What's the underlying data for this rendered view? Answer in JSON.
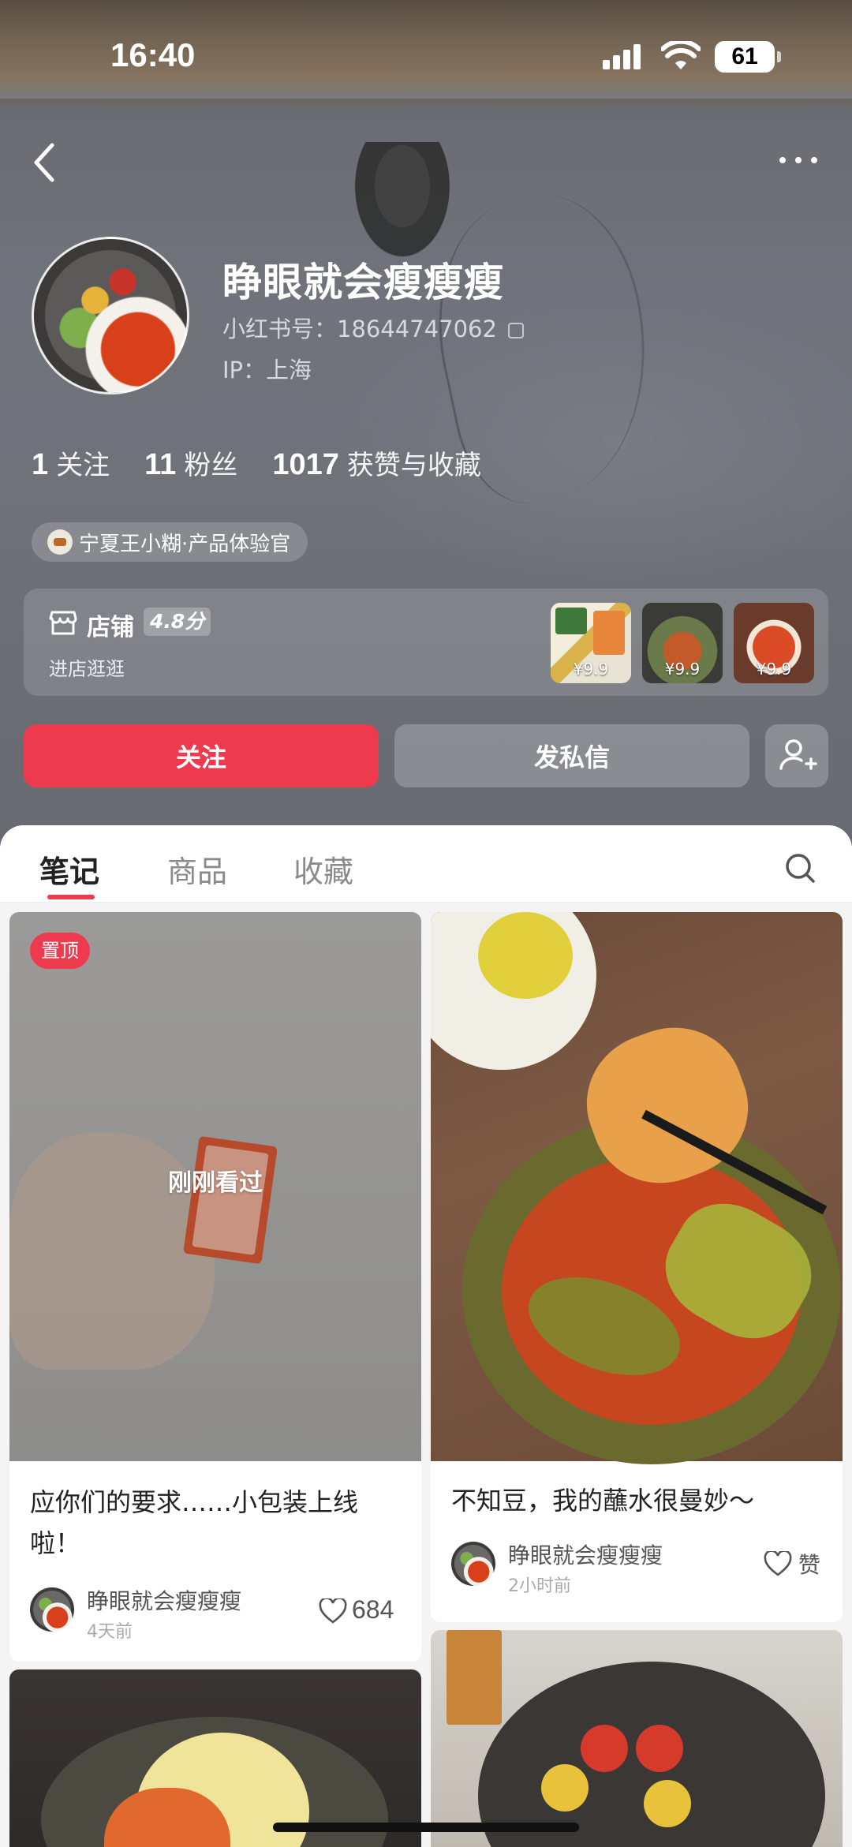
{
  "status_bar": {
    "time": "16:40",
    "battery": "61"
  },
  "profile": {
    "name": "睁眼就会瘦瘦瘦",
    "id_label": "小红书号：18644747062",
    "ip_label": "IP：上海",
    "brand_tag": "宁夏王小糊·产品体验官"
  },
  "stats": [
    {
      "value": "1",
      "label": "关注"
    },
    {
      "value": "11",
      "label": "粉丝"
    },
    {
      "value": "1017",
      "label": "获赞与收藏"
    }
  ],
  "store": {
    "title": "店铺",
    "rating": "4.8分",
    "subtitle": "进店逛逛",
    "products": [
      {
        "price": "¥9.9"
      },
      {
        "price": "¥9.9"
      },
      {
        "price": "¥9.9"
      }
    ]
  },
  "actions": {
    "follow": "关注",
    "message": "发私信"
  },
  "tabs": [
    {
      "label": "笔记",
      "active": true
    },
    {
      "label": "商品",
      "active": false
    },
    {
      "label": "收藏",
      "active": false
    }
  ],
  "notes": [
    {
      "badge": "置顶",
      "overlay": "刚刚看过",
      "title": "应你们的要求……小包装上线啦！",
      "author": "睁眼就会瘦瘦瘦",
      "time": "4天前",
      "likes": "684"
    },
    {
      "title": "不知豆，我的蘸水很曼妙～",
      "author": "睁眼就会瘦瘦瘦",
      "time": "2小时前",
      "likes": "赞"
    }
  ],
  "colors": {
    "accent": "#ee3a4e",
    "hero_bg": "#6f7279",
    "sheet_bg": "#f4f4f4"
  },
  "icons": [
    "back-icon",
    "more-icon",
    "copy-icon",
    "store-icon",
    "add-friend-icon",
    "search-icon",
    "heart-icon"
  ]
}
